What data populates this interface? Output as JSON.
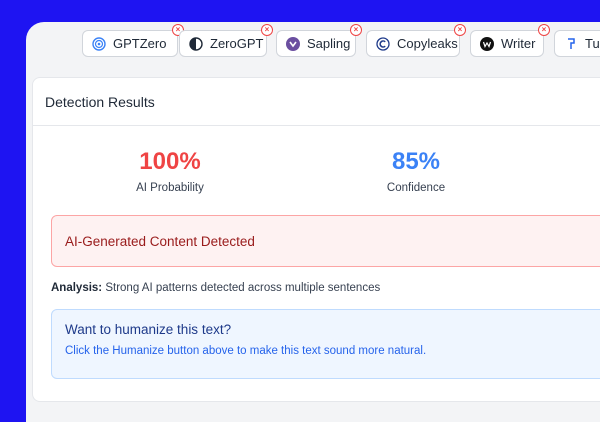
{
  "tabs": [
    {
      "label": "GPTZero",
      "icon": "gptzero-icon",
      "color": "#3b82f6"
    },
    {
      "label": "ZeroGPT",
      "icon": "zerogpt-icon",
      "color": "#1f2937"
    },
    {
      "label": "Sapling",
      "icon": "sapling-icon",
      "color": "#6b4fa0"
    },
    {
      "label": "Copyleaks",
      "icon": "copyleaks-icon",
      "color": "#1e3a8a"
    },
    {
      "label": "Writer",
      "icon": "writer-icon",
      "color": "#111111"
    },
    {
      "label": "Tur",
      "icon": "turnitin-icon",
      "color": "#2563eb"
    }
  ],
  "results": {
    "title": "Detection Results",
    "ai_probability": {
      "value": "100%",
      "label": "AI Probability",
      "color": "#ef4444"
    },
    "confidence": {
      "value": "85%",
      "label": "Confidence",
      "color": "#3b82f6"
    },
    "alert": "AI-Generated Content Detected",
    "analysis": {
      "label": "Analysis:",
      "text": " Strong AI patterns detected across multiple sentences"
    },
    "humanize": {
      "title": "Want to humanize this text?",
      "description": "Click the Humanize button above to make this text sound more natural."
    }
  }
}
